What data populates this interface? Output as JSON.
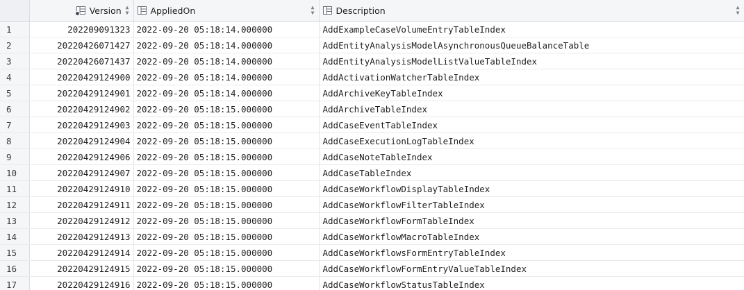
{
  "columns": {
    "version": "Version",
    "applied_on": "AppliedOn",
    "description": "Description"
  },
  "icons": {
    "column": "table-column-icon",
    "key": "primary-key-icon",
    "sort": "sort-arrows-icon"
  },
  "rows": [
    {
      "index": "1",
      "version": "202209091323",
      "applied_on": "2022-09-20 05:18:14.000000",
      "description": "AddExampleCaseVolumeEntryTableIndex"
    },
    {
      "index": "2",
      "version": "20220426071427",
      "applied_on": "2022-09-20 05:18:14.000000",
      "description": "AddEntityAnalysisModelAsynchronousQueueBalanceTable"
    },
    {
      "index": "3",
      "version": "20220426071437",
      "applied_on": "2022-09-20 05:18:14.000000",
      "description": "AddEntityAnalysisModelListValueTableIndex"
    },
    {
      "index": "4",
      "version": "20220429124900",
      "applied_on": "2022-09-20 05:18:14.000000",
      "description": "AddActivationWatcherTableIndex"
    },
    {
      "index": "5",
      "version": "20220429124901",
      "applied_on": "2022-09-20 05:18:14.000000",
      "description": "AddArchiveKeyTableIndex"
    },
    {
      "index": "6",
      "version": "20220429124902",
      "applied_on": "2022-09-20 05:18:15.000000",
      "description": "AddArchiveTableIndex"
    },
    {
      "index": "7",
      "version": "20220429124903",
      "applied_on": "2022-09-20 05:18:15.000000",
      "description": "AddCaseEventTableIndex"
    },
    {
      "index": "8",
      "version": "20220429124904",
      "applied_on": "2022-09-20 05:18:15.000000",
      "description": "AddCaseExecutionLogTableIndex"
    },
    {
      "index": "9",
      "version": "20220429124906",
      "applied_on": "2022-09-20 05:18:15.000000",
      "description": "AddCaseNoteTableIndex"
    },
    {
      "index": "10",
      "version": "20220429124907",
      "applied_on": "2022-09-20 05:18:15.000000",
      "description": "AddCaseTableIndex"
    },
    {
      "index": "11",
      "version": "20220429124910",
      "applied_on": "2022-09-20 05:18:15.000000",
      "description": "AddCaseWorkflowDisplayTableIndex"
    },
    {
      "index": "12",
      "version": "20220429124911",
      "applied_on": "2022-09-20 05:18:15.000000",
      "description": "AddCaseWorkflowFilterTableIndex"
    },
    {
      "index": "13",
      "version": "20220429124912",
      "applied_on": "2022-09-20 05:18:15.000000",
      "description": "AddCaseWorkflowFormTableIndex"
    },
    {
      "index": "14",
      "version": "20220429124913",
      "applied_on": "2022-09-20 05:18:15.000000",
      "description": "AddCaseWorkflowMacroTableIndex"
    },
    {
      "index": "15",
      "version": "20220429124914",
      "applied_on": "2022-09-20 05:18:15.000000",
      "description": "AddCaseWorkflowsFormEntryTableIndex"
    },
    {
      "index": "16",
      "version": "20220429124915",
      "applied_on": "2022-09-20 05:18:15.000000",
      "description": "AddCaseWorkflowFormEntryValueTableIndex"
    },
    {
      "index": "17",
      "version": "20220429124916",
      "applied_on": "2022-09-20 05:18:15.000000",
      "description": "AddCaseWorkflowStatusTableIndex"
    }
  ]
}
